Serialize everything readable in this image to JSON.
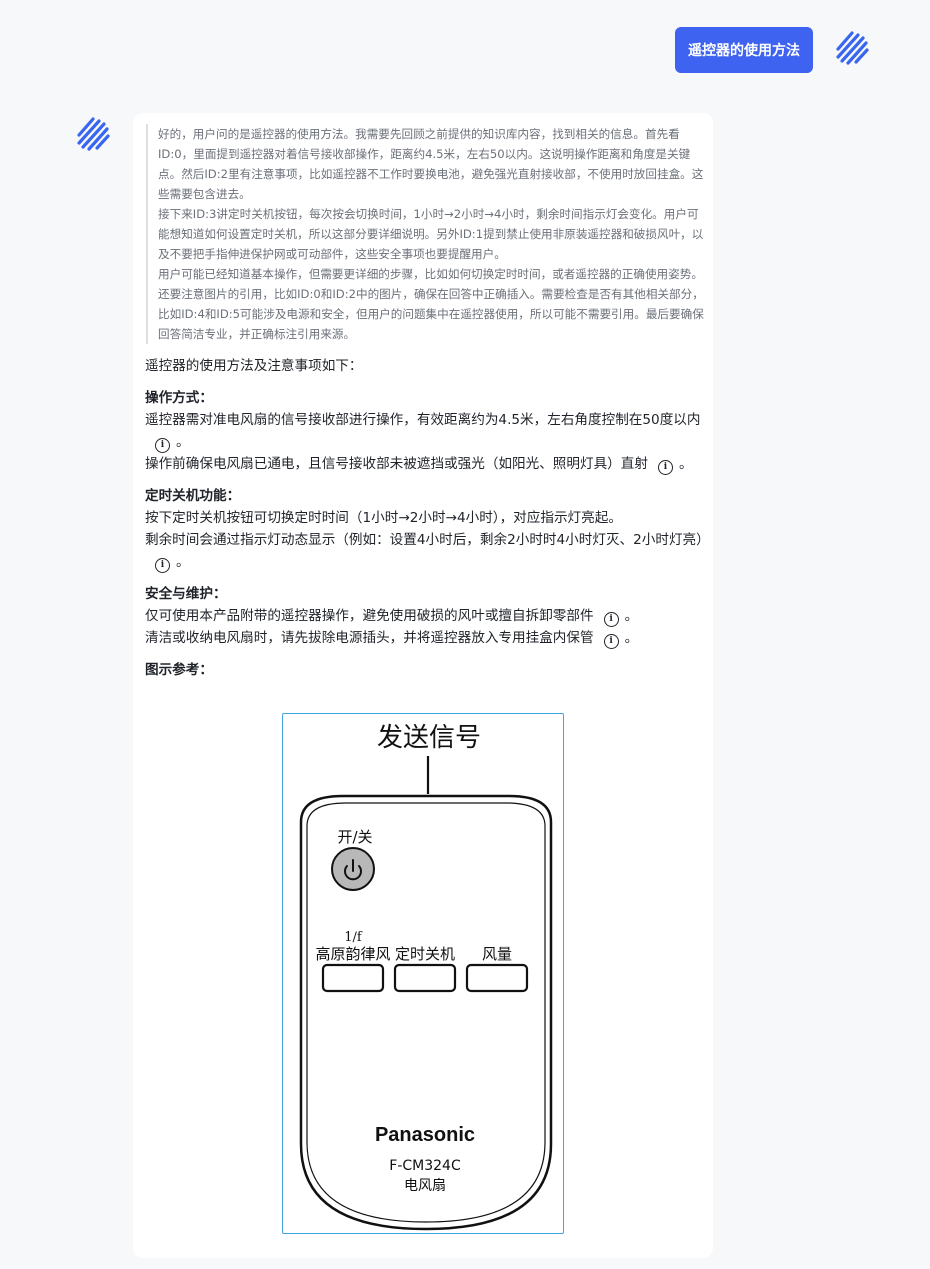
{
  "user_message": "遥控器的使用方法",
  "thinking": [
    "好的，用户问的是遥控器的使用方法。我需要先回顾之前提供的知识库内容，找到相关的信息。首先看ID:0，里面提到遥控器对着信号接收部操作，距离约4.5米，左右50以内。这说明操作距离和角度是关键点。然后ID:2里有注意事项，比如遥控器不工作时要换电池，避免强光直射接收部，不使用时放回挂盒。这些需要包含进去。",
    "接下来ID:3讲定时关机按钮，每次按会切换时间，1小时→2小时→4小时，剩余时间指示灯会变化。用户可能想知道如何设置定时关机，所以这部分要详细说明。另外ID:1提到禁止使用非原装遥控器和破损风叶，以及不要把手指伸进保护网或可动部件，这些安全事项也要提醒用户。",
    "用户可能已经知道基本操作，但需要更详细的步骤，比如如何切换定时时间，或者遥控器的正确使用姿势。还要注意图片的引用，比如ID:0和ID:2中的图片，确保在回答中正确插入。需要检查是否有其他相关部分，比如ID:4和ID:5可能涉及电源和安全，但用户的问题集中在遥控器使用，所以可能不需要引用。最后要确保回答简洁专业，并正确标注引用来源。"
  ],
  "answer": {
    "intro": "遥控器的使用方法及注意事项如下：",
    "sections": [
      {
        "heading": "操作方式",
        "lines": [
          "遥控器需对准电风扇的信号接收部进行操作，有效距离约为4.5米，左右角度控制在50度以内",
          "操作前确保电风扇已通电，且信号接收部未被遮挡或强光（如阳光、照明灯具）直射"
        ]
      },
      {
        "heading": "定时关机功能",
        "lines": [
          "按下定时关机按钮可切换定时时间（1小时→2小时→4小时），对应指示灯亮起。",
          "剩余时间会通过指示灯动态显示（例如：设置4小时后，剩余2小时时4小时灯灭、2小时灯亮）"
        ]
      },
      {
        "heading": "安全与维护",
        "lines": [
          "仅可使用本产品附带的遥控器操作，避免使用破损的风叶或擅自拆卸零部件",
          "清洁或收纳电风扇时，请先拔除电源插头，并将遥控器放入专用挂盒内保管"
        ]
      }
    ],
    "figure_heading": "图示参考",
    "colon": "：",
    "period": "。",
    "cite_glyph": "i"
  },
  "figure": {
    "signal_label": "发送信号",
    "power_label": "开/关",
    "button1_label_top": "1/f",
    "button1_label": "高原韵律风",
    "button2_label": "定时关机",
    "button3_label": "风量",
    "brand": "Panasonic",
    "model": "F-CM324C",
    "product": "电风扇"
  },
  "colors": {
    "accent": "#3e63f0",
    "figure_border": "#3ea6e8"
  }
}
